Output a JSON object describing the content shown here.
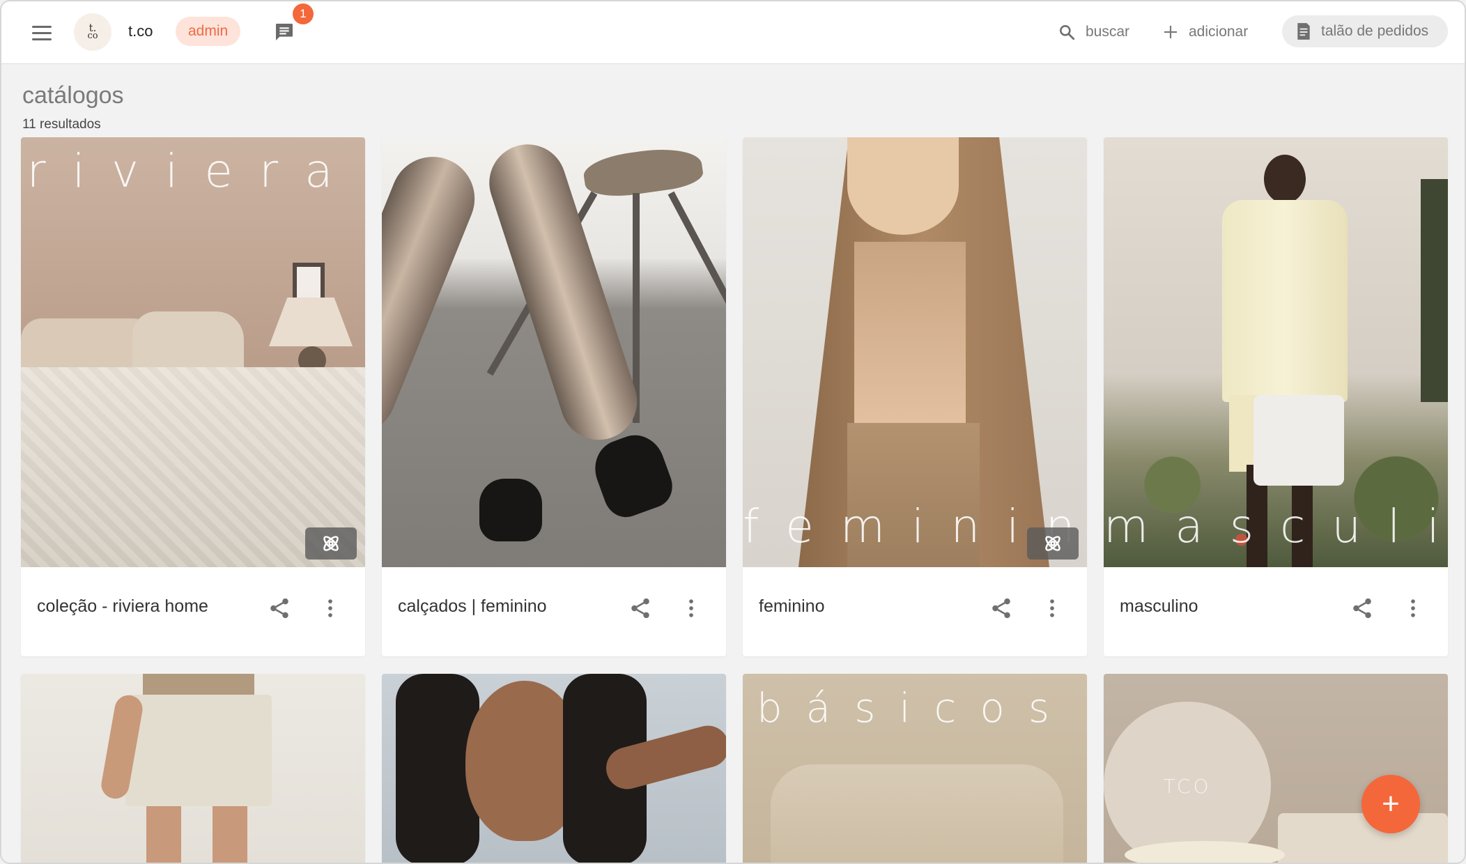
{
  "header": {
    "logo_text": "t.co",
    "brand_name": "t.co",
    "role_badge": "admin",
    "notifications_count": "1",
    "search_label": "buscar",
    "add_label": "adicionar",
    "orders_label": "talão de pedidos"
  },
  "page": {
    "title": "catálogos",
    "results": "11 resultados"
  },
  "catalogs": [
    {
      "title": "coleção - riviera home",
      "overlay": "riviera"
    },
    {
      "title": "calçados | feminino",
      "overlay": ""
    },
    {
      "title": "feminino",
      "overlay": "feminino"
    },
    {
      "title": "masculino",
      "overlay": "masculino"
    },
    {
      "title": "",
      "overlay": ""
    },
    {
      "title": "",
      "overlay": ""
    },
    {
      "title": "",
      "overlay": "básicos"
    },
    {
      "title": "",
      "overlay": "TCO"
    }
  ],
  "fab_label": "+",
  "colors": {
    "accent": "#f4673b",
    "badge_bg": "#fde3da",
    "background": "#f2f2f2"
  }
}
